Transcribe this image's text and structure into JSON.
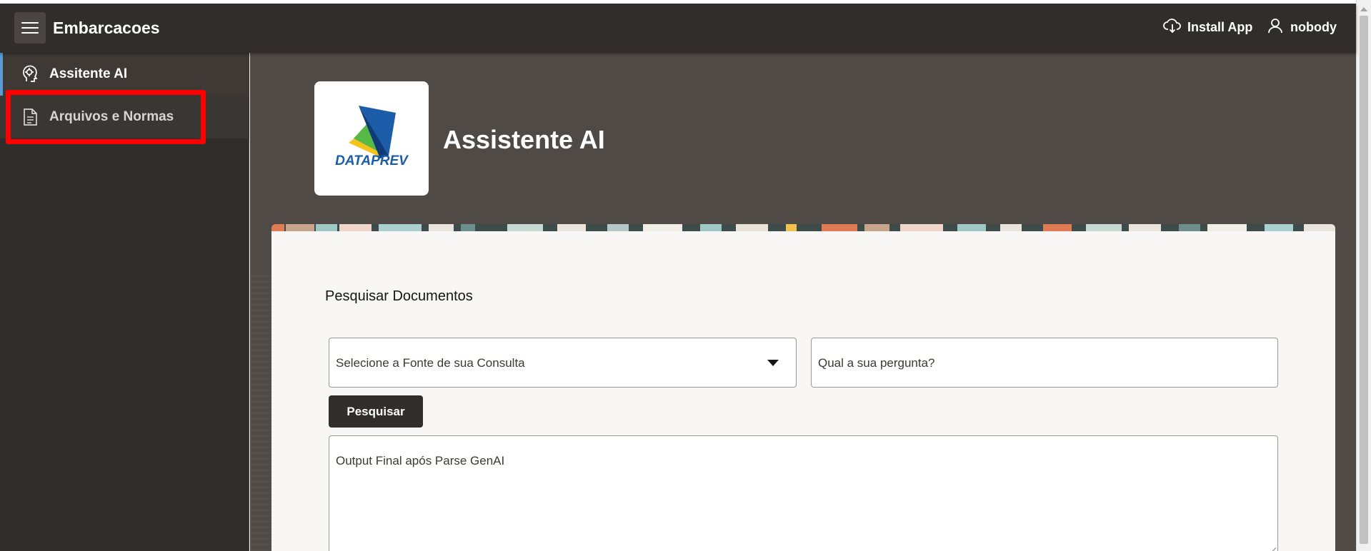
{
  "app": {
    "title": "Embarcacoes"
  },
  "header": {
    "install_label": "Install App",
    "user_label": "nobody"
  },
  "sidebar": {
    "items": [
      {
        "label": "Assitente AI",
        "icon": "ai-assistant-icon"
      },
      {
        "label": "Arquivos e Normas",
        "icon": "document-icon"
      }
    ]
  },
  "hero": {
    "logo_text": "DATAPREV",
    "title": "Assistente AI"
  },
  "form": {
    "section_title": "Pesquisar Documentos",
    "source_select_value": "Selecione a Fonte de sua Consulta",
    "question_placeholder": "Qual a sua pergunta?",
    "search_button_label": "Pesquisar",
    "output_placeholder": "Output Final após Parse GenAI"
  },
  "colors": {
    "header_bg": "#312d2a",
    "sidebar_bg": "#312d2a",
    "main_bg": "#4f4a46",
    "accent_blue": "#5b9bd5",
    "highlight_red": "#ff0000",
    "button_bg": "#312d2a"
  }
}
